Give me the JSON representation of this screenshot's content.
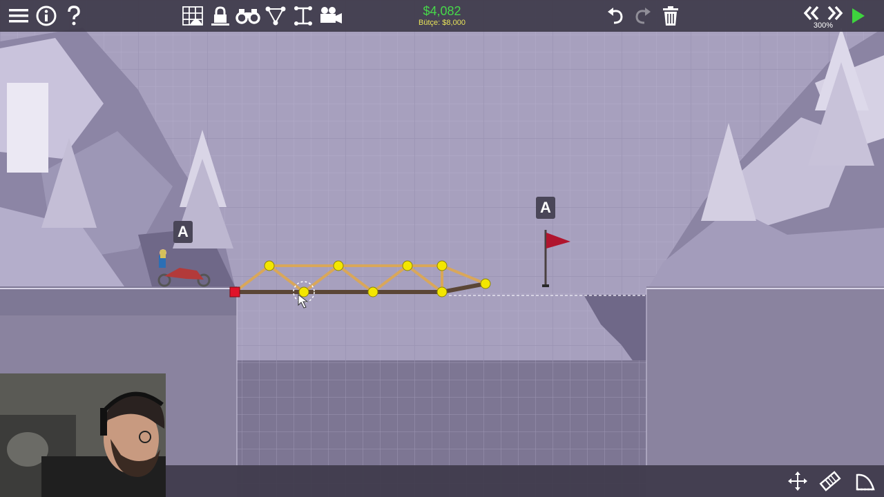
{
  "hud": {
    "menu_icon": "hamburger-menu-icon",
    "info_icon": "info-icon",
    "help_icon": "question-mark-icon",
    "tools": [
      {
        "name": "grid-arch-tool",
        "icon": "grid-arch-icon"
      },
      {
        "name": "lock-tool",
        "icon": "lock-icon"
      },
      {
        "name": "binoculars-tool",
        "icon": "binoculars-icon"
      },
      {
        "name": "joint-tool",
        "icon": "triangle-joint-icon"
      },
      {
        "name": "measure-tool",
        "icon": "measure-icon"
      },
      {
        "name": "camera-tool",
        "icon": "video-camera-icon"
      }
    ],
    "cost": "$4,082",
    "budget": "Bütçe: $8,000",
    "undo_icon": "undo-icon",
    "redo_icon": "redo-icon",
    "delete_icon": "trash-icon",
    "rewind_icon": "rewind-icon",
    "fast_forward_icon": "fast-forward-icon",
    "speed": "300%",
    "play_icon": "play-icon",
    "bottom_tools": [
      "move-icon",
      "eraser-icon",
      "shape-icon"
    ]
  },
  "scene": {
    "start_anchor_label": "A",
    "goal_anchor_label": "A",
    "flag_color": "#b0152e",
    "joint_color": "#f3e600",
    "anchor_joint_color": "#e0122a",
    "wood_color": "#d9a75a",
    "road_color": "#5b4636"
  }
}
